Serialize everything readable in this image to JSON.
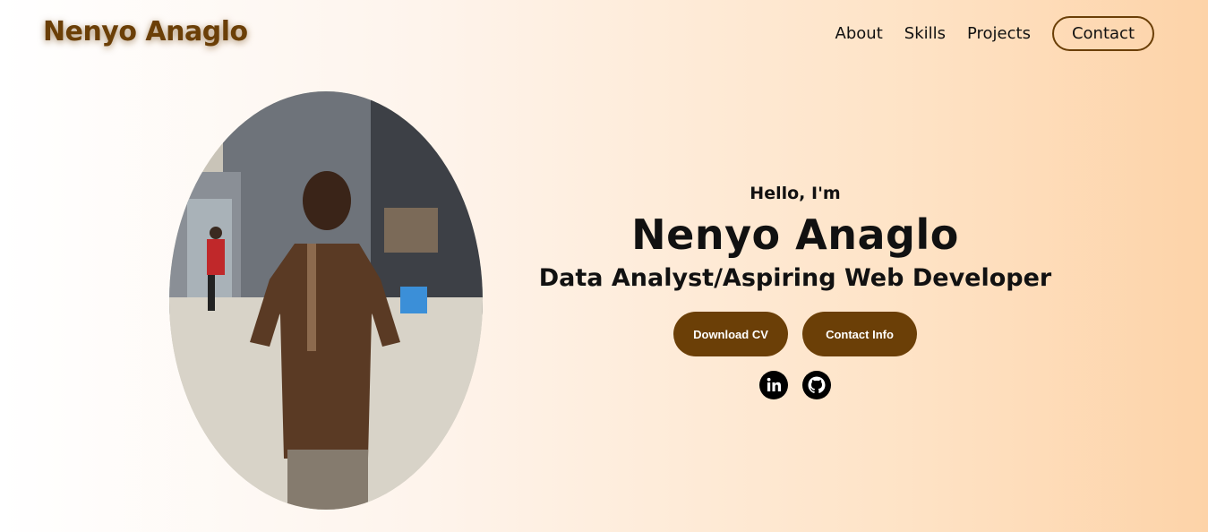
{
  "brand": {
    "name": "Nenyo Anaglo"
  },
  "nav": {
    "items": [
      "About",
      "Skills",
      "Projects"
    ],
    "contact_label": "Contact"
  },
  "hero": {
    "greeting": "Hello, I'm",
    "name": "Nenyo Anaglo",
    "role": "Data Analyst/Aspiring Web Developer",
    "download_label": "Download CV",
    "contact_info_label": "Contact Info",
    "social_icons": [
      "linkedin-icon",
      "github-icon"
    ]
  },
  "colors": {
    "accent": "#6b3f07",
    "bg_left": "#ffffff",
    "bg_right": "#fdd3a8"
  }
}
